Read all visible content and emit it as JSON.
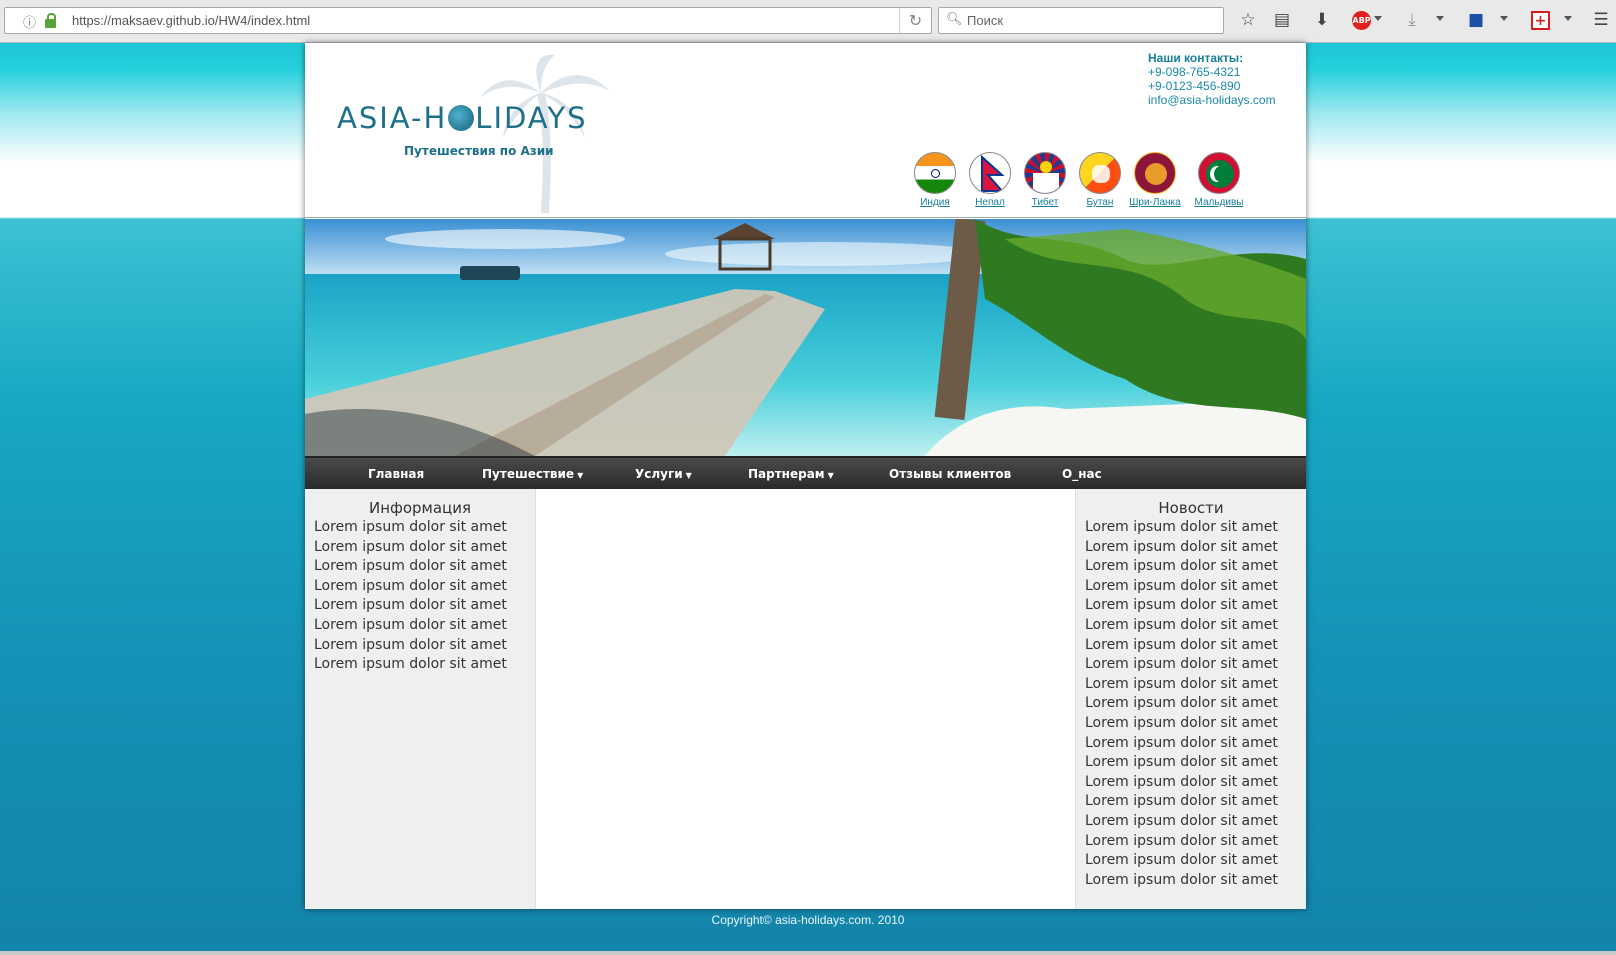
{
  "browser": {
    "url": "https://maksaev.github.io/HW4/index.html",
    "search_placeholder": "Поиск"
  },
  "header": {
    "logo_text_left": "ASIA-H",
    "logo_text_right": "LIDAYS",
    "tagline": "Путешествия по Азии",
    "contacts": {
      "title": "Наши контакты:",
      "phone1": "+9-098-765-4321",
      "phone2": "+9-0123-456-890",
      "email": "info@asia-holidays.com"
    },
    "flags": [
      {
        "label": "Индия"
      },
      {
        "label": "Непал"
      },
      {
        "label": "Тибет"
      },
      {
        "label": "Бутан"
      },
      {
        "label": "Шри-Ланка"
      },
      {
        "label": "Мальдивы"
      }
    ]
  },
  "nav": {
    "items": [
      {
        "label": "Главная",
        "has_dropdown": false
      },
      {
        "label": "Путешествие",
        "has_dropdown": true
      },
      {
        "label": "Услуги",
        "has_dropdown": true
      },
      {
        "label": "Партнерам",
        "has_dropdown": true
      },
      {
        "label": "Отзывы клиентов",
        "has_dropdown": false
      },
      {
        "label": "О_нас",
        "has_dropdown": false
      }
    ],
    "dropdown_arrow": "▼"
  },
  "left_column": {
    "title": "Информация",
    "items": [
      "Lorem ipsum dolor sit amet",
      "Lorem ipsum dolor sit amet",
      "Lorem ipsum dolor sit amet",
      "Lorem ipsum dolor sit amet",
      "Lorem ipsum dolor sit amet",
      "Lorem ipsum dolor sit amet",
      "Lorem ipsum dolor sit amet",
      "Lorem ipsum dolor sit amet"
    ]
  },
  "right_column": {
    "title": "Новости",
    "items": [
      "Lorem ipsum dolor sit amet",
      "Lorem ipsum dolor sit amet",
      "Lorem ipsum dolor sit amet",
      "Lorem ipsum dolor sit amet",
      "Lorem ipsum dolor sit amet",
      "Lorem ipsum dolor sit amet",
      "Lorem ipsum dolor sit amet",
      "Lorem ipsum dolor sit amet",
      "Lorem ipsum dolor sit amet",
      "Lorem ipsum dolor sit amet",
      "Lorem ipsum dolor sit amet",
      "Lorem ipsum dolor sit amet",
      "Lorem ipsum dolor sit amet",
      "Lorem ipsum dolor sit amet",
      "Lorem ipsum dolor sit amet",
      "Lorem ipsum dolor sit amet",
      "Lorem ipsum dolor sit amet",
      "Lorem ipsum dolor sit amet",
      "Lorem ipsum dolor sit amet"
    ]
  },
  "footer": {
    "copyright": "Copyright© asia-holidays.com. 2010"
  },
  "colors": {
    "brand": "#1d6f8a",
    "link": "#167e9c",
    "nav_bg": "#2f2f2f",
    "sidebar_bg": "#efefef"
  }
}
